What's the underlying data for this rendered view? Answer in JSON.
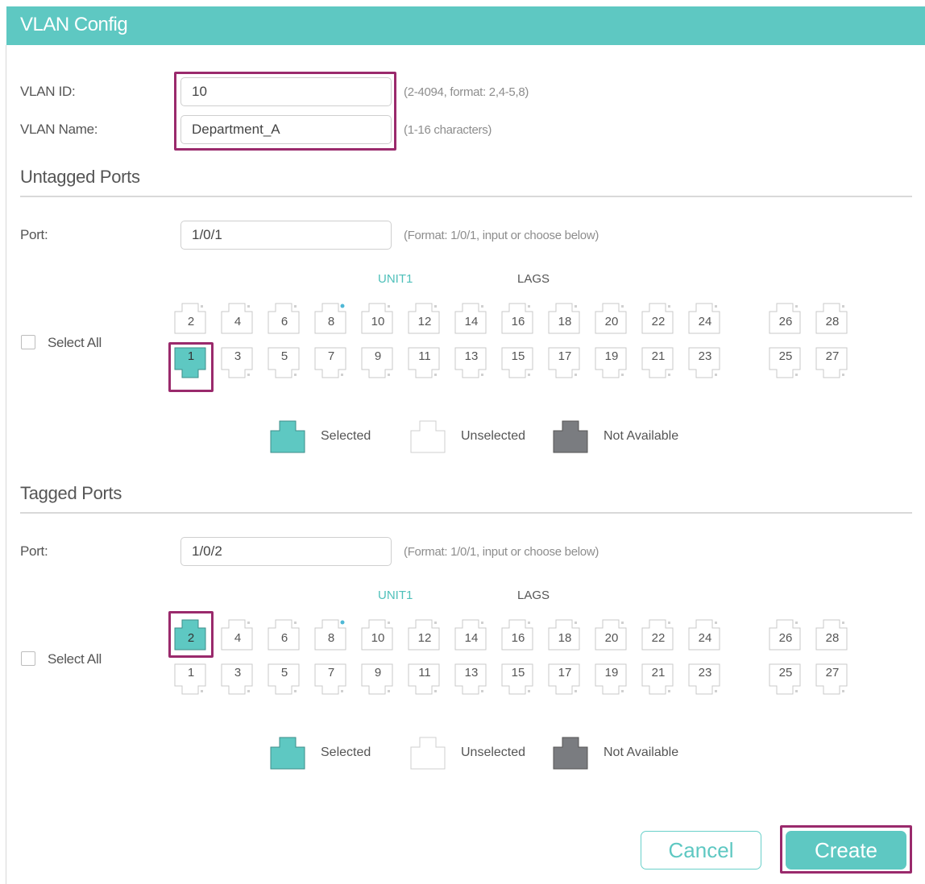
{
  "window": {
    "title": "VLAN Config"
  },
  "form": {
    "vlan_id_label": "VLAN ID:",
    "vlan_id_value": "10",
    "vlan_id_hint": "(2-4094, format: 2,4-5,8)",
    "vlan_name_label": "VLAN Name:",
    "vlan_name_value": "Department_A",
    "vlan_name_hint": "(1-16 characters)"
  },
  "sections": [
    {
      "title": "Untagged Ports",
      "port_label": "Port:",
      "port_value": "1/0/1",
      "port_hint": "(Format: 1/0/1, input or choose below)",
      "unit_label": "UNIT1",
      "lags_label": "LAGS",
      "select_all_label": "Select All",
      "selected_ports": [
        "1"
      ]
    },
    {
      "title": "Tagged Ports",
      "port_label": "Port:",
      "port_value": "1/0/2",
      "port_hint": "(Format: 1/0/1, input or choose below)",
      "unit_label": "UNIT1",
      "lags_label": "LAGS",
      "select_all_label": "Select All",
      "selected_ports": [
        "2"
      ]
    }
  ],
  "ports": {
    "top_row": [
      "2",
      "4",
      "6",
      "8",
      "10",
      "12",
      "14",
      "16",
      "18",
      "20",
      "22",
      "24",
      "26",
      "28"
    ],
    "bottom_row": [
      "1",
      "3",
      "5",
      "7",
      "9",
      "11",
      "13",
      "15",
      "17",
      "19",
      "21",
      "23",
      "25",
      "27"
    ]
  },
  "legend": {
    "selected": "Selected",
    "unselected": "Unselected",
    "not_available": "Not Available"
  },
  "buttons": {
    "cancel": "Cancel",
    "create": "Create"
  },
  "colors": {
    "accent": "#5ec8c2",
    "highlight_border": "#9a2a6c",
    "not_available": "#7a7c80"
  }
}
